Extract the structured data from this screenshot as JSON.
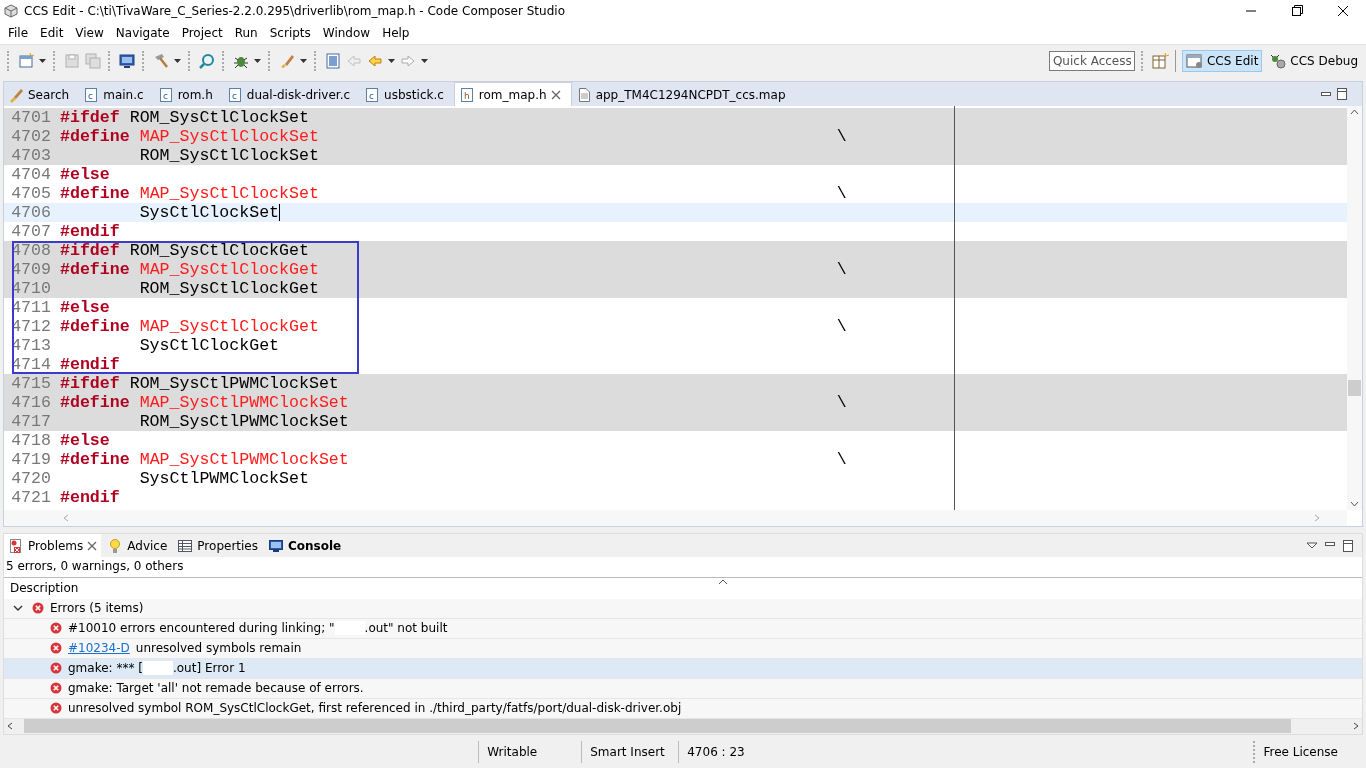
{
  "window": {
    "title": "CCS Edit - C:\\ti\\TivaWare_C_Series-2.2.0.295\\driverlib\\rom_map.h - Code Composer Studio"
  },
  "menu": [
    "File",
    "Edit",
    "View",
    "Navigate",
    "Project",
    "Run",
    "Scripts",
    "Window",
    "Help"
  ],
  "toolbar": {
    "quick_access": {
      "placeholder": "Quick Access"
    },
    "perspectives": [
      {
        "label": "CCS Edit",
        "selected": true
      },
      {
        "label": "CCS Debug",
        "selected": false
      }
    ]
  },
  "editor_tabs": [
    {
      "label": "Search",
      "kind": "search",
      "selected": false,
      "closable": false
    },
    {
      "label": "main.c",
      "kind": "c",
      "selected": false,
      "closable": false
    },
    {
      "label": "rom.h",
      "kind": "c",
      "selected": false,
      "closable": false
    },
    {
      "label": "dual-disk-driver.c",
      "kind": "c",
      "selected": false,
      "closable": false
    },
    {
      "label": "usbstick.c",
      "kind": "c",
      "selected": false,
      "closable": false
    },
    {
      "label": "rom_map.h",
      "kind": "h",
      "selected": true,
      "closable": true
    },
    {
      "label": "app_TM4C1294NCPDT_ccs.map",
      "kind": "file",
      "selected": false,
      "closable": false
    }
  ],
  "code_lines": [
    {
      "number": "4701",
      "tokens": [
        {
          "kind": "directive",
          "text": "#ifdef"
        },
        {
          "kind": "plain",
          "text": "ROM_SysCtlClockSet"
        }
      ],
      "inactive": true,
      "current": false,
      "boxed": false
    },
    {
      "number": "4702",
      "tokens": [
        {
          "kind": "directive",
          "text": "#define"
        },
        {
          "kind": "macro",
          "text": "MAP_SysCtlClockSet"
        },
        {
          "kind": "continuation",
          "text": "\\"
        }
      ],
      "inactive": true,
      "current": false,
      "boxed": false
    },
    {
      "number": "4703",
      "tokens": [
        {
          "kind": "indented",
          "text": "ROM_SysCtlClockSet"
        }
      ],
      "inactive": true,
      "current": false,
      "boxed": false
    },
    {
      "number": "4704",
      "tokens": [
        {
          "kind": "directive",
          "text": "#else"
        }
      ],
      "inactive": false,
      "current": false,
      "boxed": false
    },
    {
      "number": "4705",
      "tokens": [
        {
          "kind": "directive",
          "text": "#define"
        },
        {
          "kind": "macro",
          "text": "MAP_SysCtlClockSet"
        },
        {
          "kind": "continuation",
          "text": "\\"
        }
      ],
      "inactive": false,
      "current": false,
      "boxed": false
    },
    {
      "number": "4706",
      "tokens": [
        {
          "kind": "indented",
          "text": "SysCtlClockSet"
        }
      ],
      "inactive": false,
      "current": true,
      "boxed": false
    },
    {
      "number": "4707",
      "tokens": [
        {
          "kind": "directive",
          "text": "#endif"
        }
      ],
      "inactive": false,
      "current": false,
      "boxed": false
    },
    {
      "number": "4708",
      "tokens": [
        {
          "kind": "directive",
          "text": "#ifdef"
        },
        {
          "kind": "plain",
          "text": "ROM_SysCtlClockGet"
        }
      ],
      "inactive": true,
      "current": false,
      "boxed": true
    },
    {
      "number": "4709",
      "tokens": [
        {
          "kind": "directive",
          "text": "#define"
        },
        {
          "kind": "macro",
          "text": "MAP_SysCtlClockGet"
        },
        {
          "kind": "continuation",
          "text": "\\"
        }
      ],
      "inactive": true,
      "current": false,
      "boxed": true
    },
    {
      "number": "4710",
      "tokens": [
        {
          "kind": "indented",
          "text": "ROM_SysCtlClockGet"
        }
      ],
      "inactive": true,
      "current": false,
      "boxed": true
    },
    {
      "number": "4711",
      "tokens": [
        {
          "kind": "directive",
          "text": "#else"
        }
      ],
      "inactive": false,
      "current": false,
      "boxed": true
    },
    {
      "number": "4712",
      "tokens": [
        {
          "kind": "directive",
          "text": "#define"
        },
        {
          "kind": "macro",
          "text": "MAP_SysCtlClockGet"
        },
        {
          "kind": "continuation",
          "text": "\\"
        }
      ],
      "inactive": false,
      "current": false,
      "boxed": true
    },
    {
      "number": "4713",
      "tokens": [
        {
          "kind": "indented",
          "text": "SysCtlClockGet"
        }
      ],
      "inactive": false,
      "current": false,
      "boxed": true
    },
    {
      "number": "4714",
      "tokens": [
        {
          "kind": "directive",
          "text": "#endif"
        }
      ],
      "inactive": false,
      "current": false,
      "boxed": true
    },
    {
      "number": "4715",
      "tokens": [
        {
          "kind": "directive",
          "text": "#ifdef"
        },
        {
          "kind": "plain",
          "text": "ROM_SysCtlPWMClockSet"
        }
      ],
      "inactive": true,
      "current": false,
      "boxed": false
    },
    {
      "number": "4716",
      "tokens": [
        {
          "kind": "directive",
          "text": "#define"
        },
        {
          "kind": "macro",
          "text": "MAP_SysCtlPWMClockSet"
        },
        {
          "kind": "continuation",
          "text": "\\"
        }
      ],
      "inactive": true,
      "current": false,
      "boxed": false
    },
    {
      "number": "4717",
      "tokens": [
        {
          "kind": "indented",
          "text": "ROM_SysCtlPWMClockSet"
        }
      ],
      "inactive": true,
      "current": false,
      "boxed": false
    },
    {
      "number": "4718",
      "tokens": [
        {
          "kind": "directive",
          "text": "#else"
        }
      ],
      "inactive": false,
      "current": false,
      "boxed": false
    },
    {
      "number": "4719",
      "tokens": [
        {
          "kind": "directive",
          "text": "#define"
        },
        {
          "kind": "macro",
          "text": "MAP_SysCtlPWMClockSet"
        },
        {
          "kind": "continuation",
          "text": "\\"
        }
      ],
      "inactive": false,
      "current": false,
      "boxed": false
    },
    {
      "number": "4720",
      "tokens": [
        {
          "kind": "indented",
          "text": "SysCtlPWMClockSet"
        }
      ],
      "inactive": false,
      "current": false,
      "boxed": false
    },
    {
      "number": "4721",
      "tokens": [
        {
          "kind": "directive",
          "text": "#endif"
        }
      ],
      "inactive": false,
      "current": false,
      "boxed": false
    }
  ],
  "bottom_tabs": [
    {
      "label": "Problems",
      "kind": "problems",
      "selected": true,
      "closable": true
    },
    {
      "label": "Advice",
      "kind": "advice",
      "selected": false,
      "closable": false
    },
    {
      "label": "Properties",
      "kind": "properties",
      "selected": false,
      "closable": false
    },
    {
      "label": "Console",
      "kind": "console",
      "selected": false,
      "closable": false
    }
  ],
  "problems": {
    "summary": "5 errors, 0 warnings, 0 others",
    "column": "Description",
    "group": {
      "label": "Errors (5 items)",
      "expanded": true,
      "items": [
        {
          "text": "#10010 errors encountered during linking; \"",
          "after": ".out\" not built",
          "selected": false
        },
        {
          "link": "#10234-D",
          "text": "unresolved symbols remain",
          "selected": false
        },
        {
          "text": "gmake: *** [",
          "after": ".out] Error 1",
          "selected": true
        },
        {
          "text": "gmake: Target 'all' not remade because of errors.",
          "selected": false
        },
        {
          "text": "unresolved symbol ROM_SysCtlClockGet, first referenced in ./third_party/fatfs/port/dual-disk-driver.obj",
          "selected": false
        }
      ]
    }
  },
  "status_bar": {
    "mode": "Writable",
    "insert": "Smart Insert",
    "position": "4706 : 23",
    "license": "Free License"
  }
}
